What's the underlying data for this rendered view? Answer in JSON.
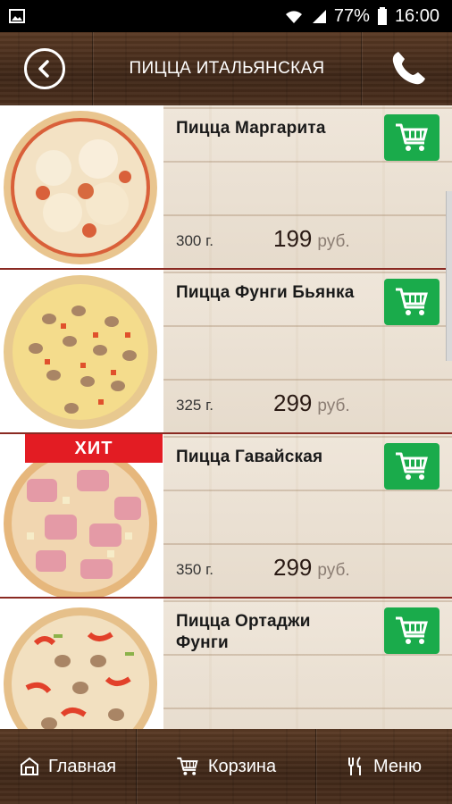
{
  "status_bar": {
    "battery": "77%",
    "time": "16:00",
    "icons": [
      "gallery-icon",
      "wifi-icon",
      "signal-icon",
      "battery-icon"
    ]
  },
  "header": {
    "title": "ПИЦЦА ИТАЛЬЯНСКАЯ",
    "back_icon": "back-arrow-icon",
    "phone_icon": "phone-icon"
  },
  "products": [
    {
      "name": "Пицца Маргарита",
      "weight": "300 г.",
      "price": "199",
      "currency": "руб.",
      "badge": ""
    },
    {
      "name": "Пицца Фунги Бьянка",
      "weight": "325 г.",
      "price": "299",
      "currency": "руб.",
      "badge": ""
    },
    {
      "name": "Пицца Гавайская",
      "weight": "350 г.",
      "price": "299",
      "currency": "руб.",
      "badge": "ХИТ"
    },
    {
      "name": "Пицца Ортаджи Фунги",
      "weight": "",
      "price": "",
      "currency": "",
      "badge": ""
    }
  ],
  "bottom_nav": {
    "home_label": "Главная",
    "cart_label": "Корзина",
    "menu_label": "Меню"
  },
  "colors": {
    "cart_button": "#1aab4b",
    "hit_badge": "#e31c23",
    "row_divider": "#8a2a22",
    "wood_dark": "#4b2f1d"
  }
}
